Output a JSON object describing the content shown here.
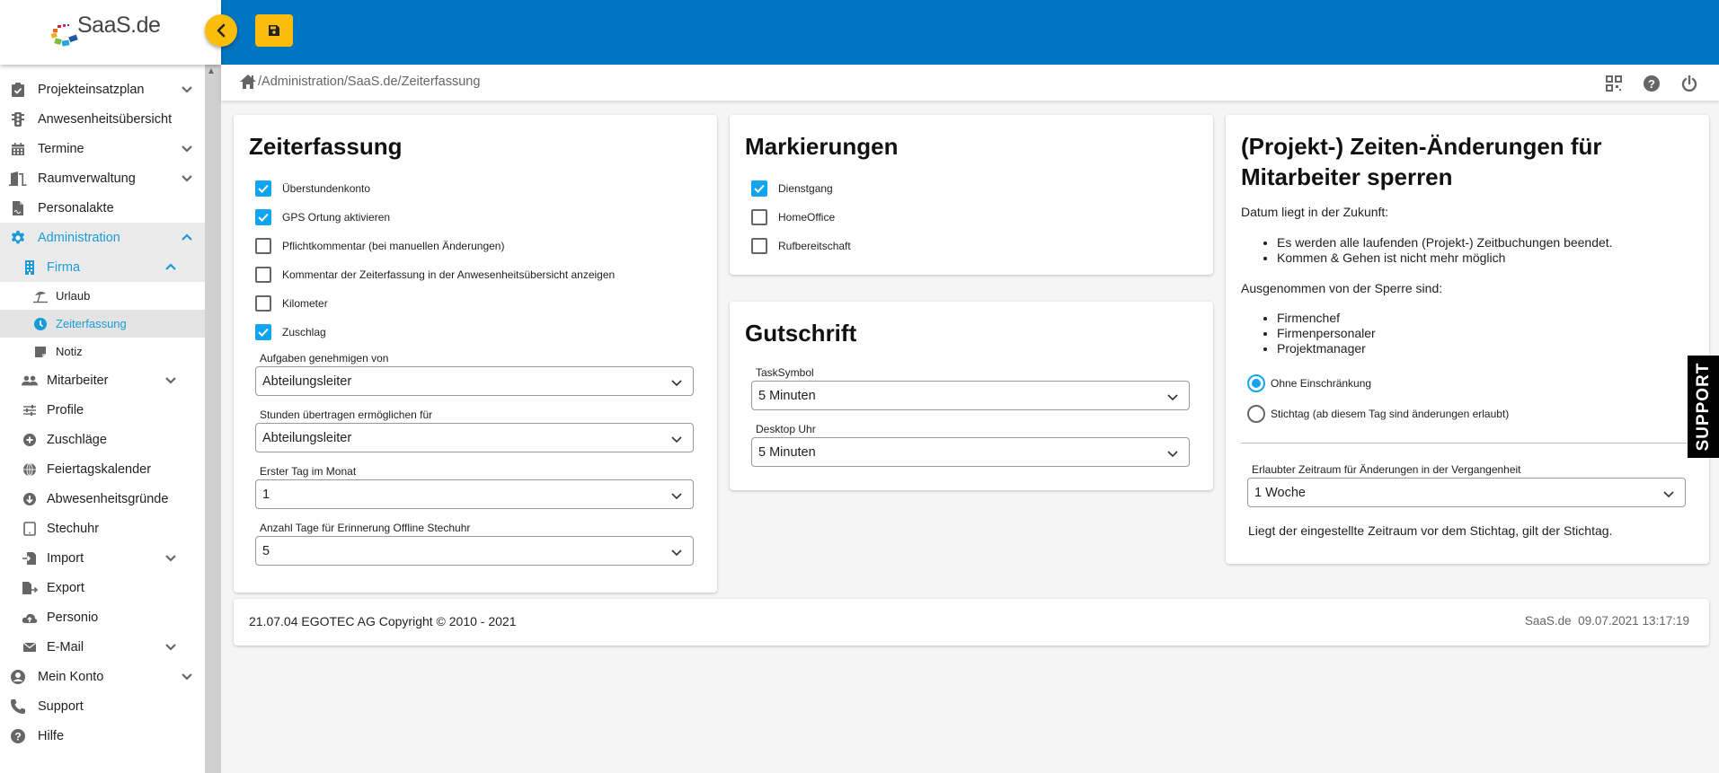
{
  "brand": {
    "logo_text": "SaaS.de",
    "topbar_color": "#0075c1",
    "accent_color": "#fbbd0c",
    "active_color": "#1a9ad6",
    "checkbox_color": "#11a5f0"
  },
  "sidebar": {
    "items": [
      {
        "label": "Projekteinsatzplan",
        "icon": "clipboard-check-icon",
        "level": 0,
        "expandable": true,
        "expanded": false
      },
      {
        "label": "Anwesenheitsübersicht",
        "icon": "traffic-light-icon",
        "level": 0,
        "expandable": false
      },
      {
        "label": "Termine",
        "icon": "calendar-icon",
        "level": 0,
        "expandable": true,
        "expanded": false
      },
      {
        "label": "Raumverwaltung",
        "icon": "door-icon",
        "level": 0,
        "expandable": true,
        "expanded": false
      },
      {
        "label": "Personalakte",
        "icon": "file-signature-icon",
        "level": 0,
        "expandable": false
      },
      {
        "label": "Administration",
        "icon": "gear-icon",
        "level": 0,
        "expandable": true,
        "expanded": true,
        "active": true
      },
      {
        "label": "Firma",
        "icon": "building-icon",
        "level": 1,
        "expandable": true,
        "expanded": true,
        "active": true
      },
      {
        "label": "Urlaub",
        "icon": "beach-umbrella-icon",
        "level": 2
      },
      {
        "label": "Zeiterfassung",
        "icon": "clock-icon",
        "level": 2,
        "active": true
      },
      {
        "label": "Notiz",
        "icon": "note-icon",
        "level": 2
      },
      {
        "label": "Mitarbeiter",
        "icon": "users-icon",
        "level": 1,
        "expandable": true,
        "expanded": false
      },
      {
        "label": "Profile",
        "icon": "sliders-icon",
        "level": 1
      },
      {
        "label": "Zuschläge",
        "icon": "plus-circle-icon",
        "level": 1
      },
      {
        "label": "Feiertagskalender",
        "icon": "globe-icon",
        "level": 1
      },
      {
        "label": "Abwesenheitsgründe",
        "icon": "arrow-down-circle-icon",
        "level": 1
      },
      {
        "label": "Stechuhr",
        "icon": "tablet-icon",
        "level": 1
      },
      {
        "label": "Import",
        "icon": "file-import-icon",
        "level": 1,
        "expandable": true,
        "expanded": false
      },
      {
        "label": "Export",
        "icon": "file-export-icon",
        "level": 1
      },
      {
        "label": "Personio",
        "icon": "cloud-upload-icon",
        "level": 1
      },
      {
        "label": "E-Mail",
        "icon": "envelope-icon",
        "level": 1,
        "expandable": true,
        "expanded": false
      },
      {
        "label": "Mein Konto",
        "icon": "user-circle-icon",
        "level": 0,
        "expandable": true,
        "expanded": false
      },
      {
        "label": "Support",
        "icon": "phone-icon",
        "level": 0
      },
      {
        "label": "Hilfe",
        "icon": "question-circle-icon",
        "level": 0
      }
    ]
  },
  "breadcrumb": {
    "path": "/Administration/SaaS.de/Zeiterfassung"
  },
  "zeiterfassung": {
    "title": "Zeiterfassung",
    "checkboxes": [
      {
        "label": "Überstundenkonto",
        "checked": true
      },
      {
        "label": "GPS Ortung aktivieren",
        "checked": true
      },
      {
        "label": "Pflichtkommentar (bei manuellen Änderungen)",
        "checked": false
      },
      {
        "label": "Kommentar der Zeiterfassung in der Anwesenheitsübersicht anzeigen",
        "checked": false
      },
      {
        "label": "Kilometer",
        "checked": false
      },
      {
        "label": "Zuschlag",
        "checked": true
      }
    ],
    "selects": [
      {
        "label": "Aufgaben genehmigen von",
        "value": "Abteilungsleiter"
      },
      {
        "label": "Stunden übertragen ermöglichen für",
        "value": "Abteilungsleiter"
      },
      {
        "label": "Erster Tag im Monat",
        "value": "1"
      },
      {
        "label": "Anzahl Tage für Erinnerung Offline Stechuhr",
        "value": "5"
      }
    ]
  },
  "markierungen": {
    "title": "Markierungen",
    "checkboxes": [
      {
        "label": "Dienstgang",
        "checked": true
      },
      {
        "label": "HomeOffice",
        "checked": false
      },
      {
        "label": "Rufbereitschaft",
        "checked": false
      }
    ]
  },
  "gutschrift": {
    "title": "Gutschrift",
    "selects": [
      {
        "label": "TaskSymbol",
        "value": "5 Minuten"
      },
      {
        "label": "Desktop Uhr",
        "value": "5 Minuten"
      }
    ]
  },
  "sperren": {
    "title_line1": "(Projekt-) Zeiten-Änderungen für",
    "title_line2": "Mitarbeiter sperren",
    "future_heading": "Datum liegt in der Zukunft:",
    "future_items": [
      "Es werden alle laufenden (Projekt-) Zeitbuchungen beendet.",
      "Kommen & Gehen ist nicht mehr möglich"
    ],
    "exempt_heading": "Ausgenommen von der Sperre sind:",
    "exempt_items": [
      "Firmenchef",
      "Firmenpersonaler",
      "Projektmanager"
    ],
    "radios": [
      {
        "label": "Ohne Einschränkung",
        "selected": true
      },
      {
        "label": "Stichtag (ab diesem Tag sind änderungen erlaubt)",
        "selected": false
      }
    ],
    "period_label": "Erlaubter Zeitraum für Änderungen in der Vergangenheit",
    "period_value": "1 Woche",
    "note": "Liegt der eingestellte Zeitraum vor dem Stichtag, gilt der Stichtag."
  },
  "footer": {
    "copyright": "21.07.04 EGOTEC AG Copyright © 2010 - 2021",
    "right": "SaaS.de  09.07.2021 13:17:19"
  },
  "support_tab": {
    "label": "SUPPORT"
  }
}
